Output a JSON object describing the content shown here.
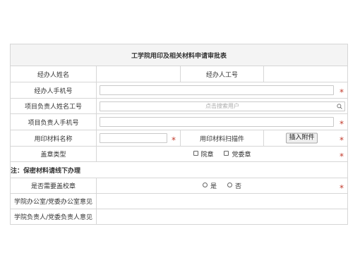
{
  "form": {
    "title": "工学院用印及相关材料申请审批表",
    "handler_name_label": "经办人姓名",
    "handler_id_label": "经办人工号",
    "handler_phone_label": "经办人手机号",
    "leader_label": "项目负责人姓名工号",
    "leader_placeholder": "点击搜索用户",
    "leader_phone_label": "项目负责人手机号",
    "material_name_label": "用印材料名称",
    "scan_label": "用印材料扫描件",
    "attach_button": "插入附件",
    "seal_type_label": "盖章类型",
    "seal_options": [
      "院章",
      "党委章"
    ],
    "note": "注：保密材料请线下办理",
    "school_seal_label": "是否需要盖校章",
    "school_seal_options": [
      "是",
      "否"
    ],
    "office_opinion_label": "学院办公室/党委办公室意见",
    "dean_opinion_label": "学院负责人/党委负责人意见",
    "required_mark": "*"
  },
  "icons": {
    "search": "search-icon",
    "checkbox": "checkbox-icon",
    "radio": "radio-icon"
  },
  "colors": {
    "border": "#d6d6d6",
    "title_bg": "#f4f4f4",
    "required": "#c23a2b",
    "note": "#e8231a",
    "placeholder": "#ababab"
  }
}
